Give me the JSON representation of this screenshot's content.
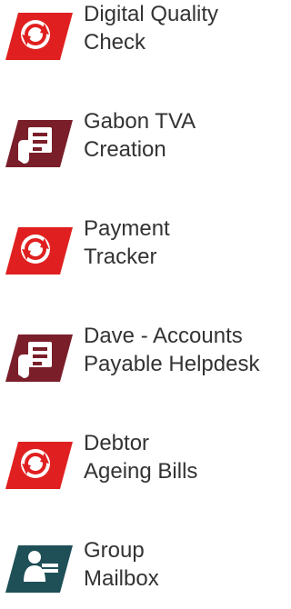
{
  "apps": [
    {
      "line1": "Digital Quality",
      "line2": "Check",
      "icon": "red-gear-refresh-icon",
      "color": "#e02020"
    },
    {
      "line1": "Gabon TVA",
      "line2": "Creation",
      "icon": "hand-document-icon",
      "color": "#7a1f2a"
    },
    {
      "line1": "Payment",
      "line2": "Tracker",
      "icon": "red-gear-refresh-icon",
      "color": "#e02020"
    },
    {
      "line1": "Dave - Accounts",
      "line2": "Payable Helpdesk",
      "icon": "hand-document-icon",
      "color": "#7a1f2a"
    },
    {
      "line1": "Debtor",
      "line2": "Ageing Bills",
      "icon": "red-gear-refresh-icon",
      "color": "#e02020"
    },
    {
      "line1": "Group",
      "line2": "Mailbox",
      "icon": "person-mailbox-icon",
      "color": "#1f4f57"
    }
  ]
}
